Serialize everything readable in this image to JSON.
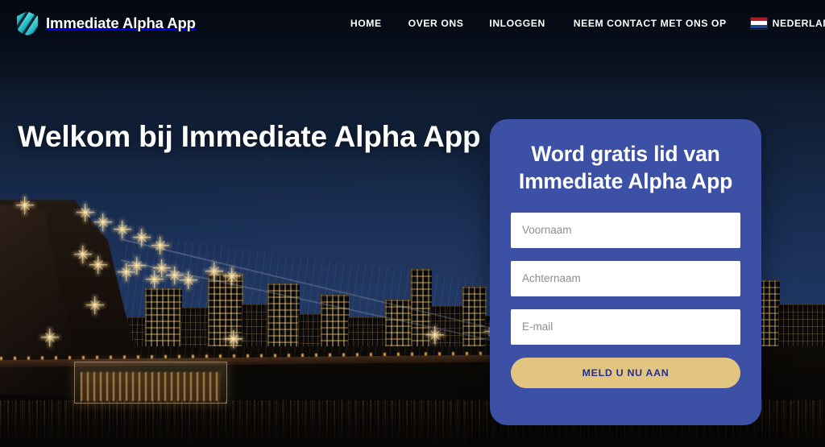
{
  "site": {
    "brand_name": "Immediate Alpha App",
    "logo_icon": "hexagon-stripes-logo-icon"
  },
  "nav": {
    "items": [
      {
        "label": "HOME",
        "name": "nav-link-home"
      },
      {
        "label": "OVER ONS",
        "name": "nav-link-over-ons"
      },
      {
        "label": "INLOGGEN",
        "name": "nav-link-inloggen"
      },
      {
        "label": "NEEM CONTACT MET ONS OP",
        "name": "nav-link-contact"
      }
    ],
    "language": {
      "label": "NEDERLANDS",
      "flag_icon": "netherlands-flag-icon",
      "flag_colors": [
        "#ae1c28",
        "#ffffff",
        "#21468b"
      ],
      "chevron_icon": "chevron-down-icon"
    }
  },
  "hero": {
    "headline": "Welkom bij Immediate Alpha App",
    "background_image": "new-york-city-night-skyline-brooklyn-bridge"
  },
  "signup": {
    "title": "Word gratis lid van Immediate Alpha App",
    "fields": [
      {
        "name": "first-name-input",
        "placeholder": "Voornaam",
        "value": ""
      },
      {
        "name": "last-name-input",
        "placeholder": "Achternaam",
        "value": ""
      },
      {
        "name": "email-input",
        "placeholder": "E-mail",
        "value": ""
      }
    ],
    "submit_label": "MELD U NU AAN"
  },
  "colors": {
    "card_blue": "#3c50a6",
    "button_tan": "#e3c582",
    "button_text": "#232f8a",
    "brand_teal": "#2ec4c9",
    "sky_dark": "#0a1222"
  }
}
